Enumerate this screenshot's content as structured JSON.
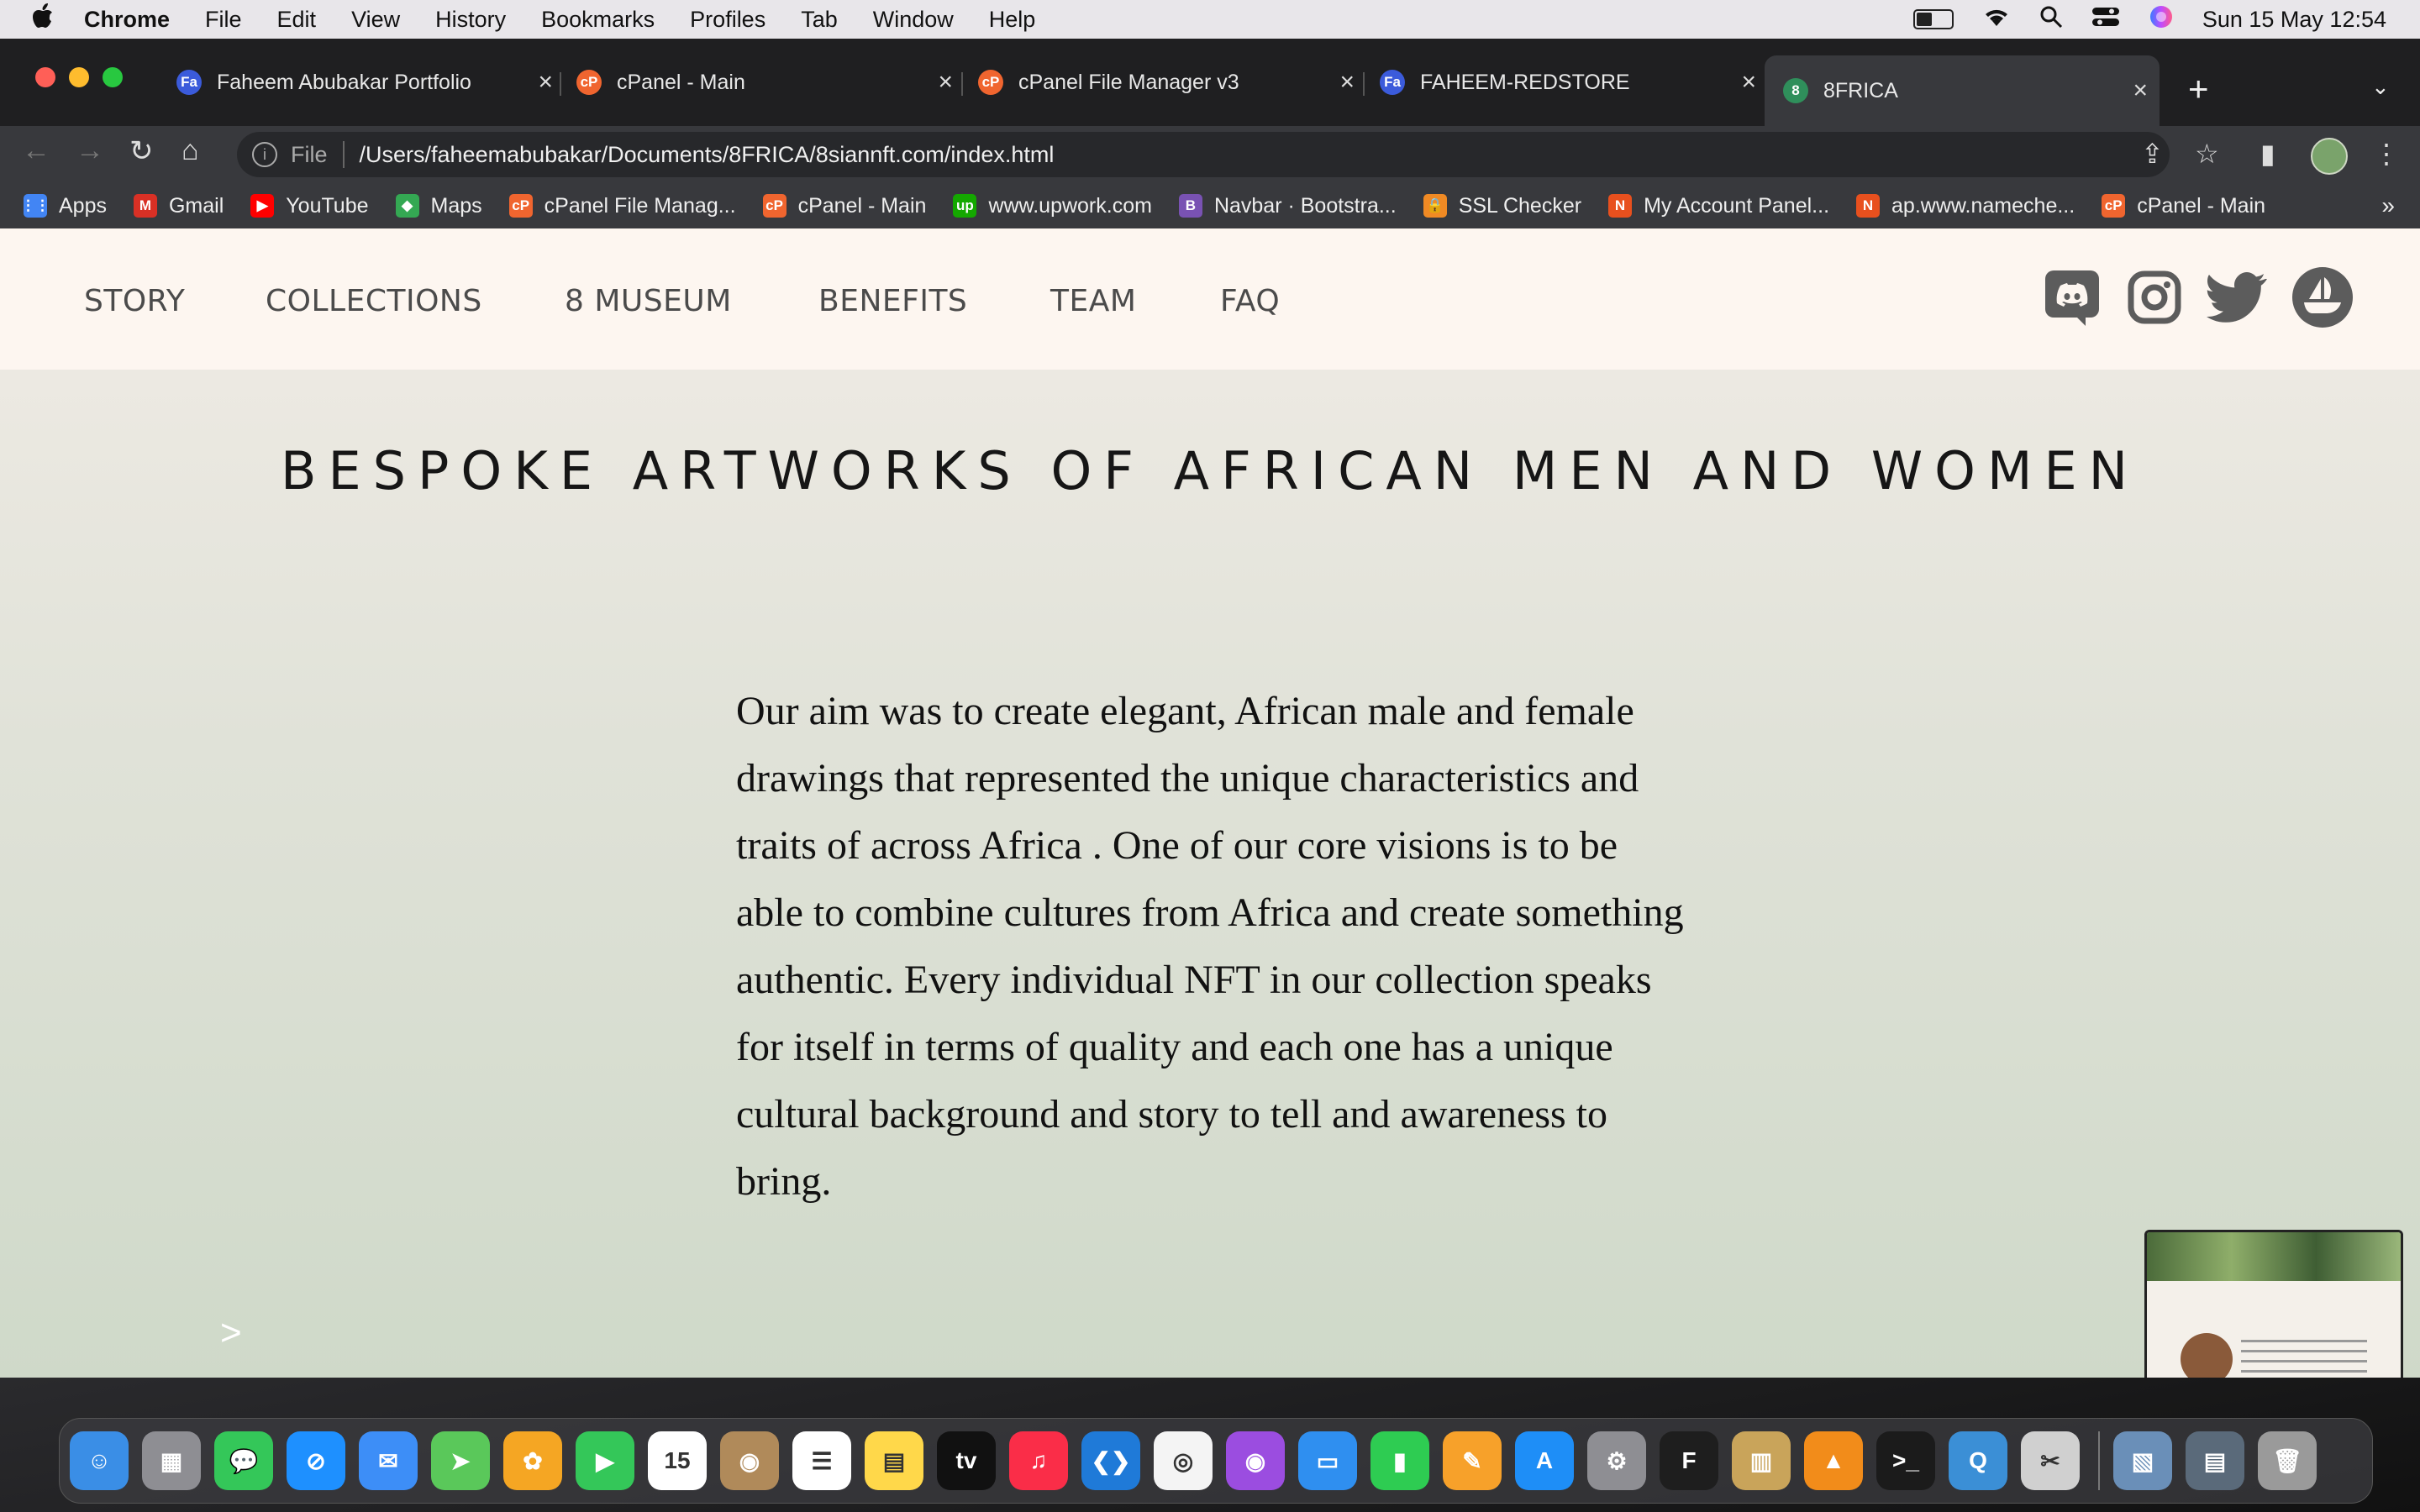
{
  "menubar": {
    "apple": "",
    "items": [
      "Chrome",
      "File",
      "Edit",
      "View",
      "History",
      "Bookmarks",
      "Profiles",
      "Tab",
      "Window",
      "Help"
    ],
    "datetime": "Sun 15 May  12:54",
    "battery_level": 0.45
  },
  "tabs": [
    {
      "title": "Faheem Abubakar Portfolio",
      "icon": "Fa",
      "color": "#3b5bdb",
      "active": false
    },
    {
      "title": "cPanel - Main",
      "icon": "cP",
      "color": "#f0652f",
      "active": false
    },
    {
      "title": "cPanel File Manager v3",
      "icon": "cP",
      "color": "#f0652f",
      "active": false
    },
    {
      "title": "FAHEEM-REDSTORE",
      "icon": "Fa",
      "color": "#3b5bdb",
      "active": false
    },
    {
      "title": "8FRICA",
      "icon": "8",
      "color": "#2f8f5b",
      "active": true
    }
  ],
  "tab_close": "×",
  "new_tab": "+",
  "tab_menu": "⌄",
  "toolbar": {
    "back": "←",
    "forward": "→",
    "reload": "↻",
    "home": "⌂",
    "scheme": "File",
    "url": "/Users/faheemabubakar/Documents/8FRICA/8siannft.com/index.html",
    "share": "⇪",
    "star": "☆",
    "sidepanel": "▮",
    "menu": "⋮"
  },
  "bookmarks": [
    {
      "label": "Apps",
      "icon": "⋮⋮",
      "color": "#4285f4"
    },
    {
      "label": "Gmail",
      "icon": "M",
      "color": "#d93025"
    },
    {
      "label": "YouTube",
      "icon": "▶",
      "color": "#ff0000"
    },
    {
      "label": "Maps",
      "icon": "◆",
      "color": "#34a853"
    },
    {
      "label": "cPanel File Manag...",
      "icon": "cP",
      "color": "#f0652f"
    },
    {
      "label": "cPanel - Main",
      "icon": "cP",
      "color": "#f0652f"
    },
    {
      "label": "www.upwork.com",
      "icon": "up",
      "color": "#14a800"
    },
    {
      "label": "Navbar · Bootstra...",
      "icon": "B",
      "color": "#7952b3"
    },
    {
      "label": "SSL Checker",
      "icon": "🔒",
      "color": "#f08a24"
    },
    {
      "label": "My Account Panel...",
      "icon": "N",
      "color": "#e8501e"
    },
    {
      "label": "ap.www.nameche...",
      "icon": "N",
      "color": "#e8501e"
    },
    {
      "label": "cPanel - Main",
      "icon": "cP",
      "color": "#f0652f"
    }
  ],
  "bookmarks_more": "»",
  "site": {
    "nav": [
      "STORY",
      "COLLECTIONS",
      "8 MUSEUM",
      "BENEFITS",
      "TEAM",
      "FAQ"
    ],
    "social_icons": [
      "discord-icon",
      "instagram-icon",
      "twitter-icon",
      "opensea-icon"
    ],
    "headline": "BESPOKE ARTWORKS OF AFRICAN MEN AND WOMEN",
    "paragraph": "Our aim was to create elegant, African male and female drawings that represented the unique characteristics and traits of across Africa . One of our core visions is to be able to combine cultures from Africa and create something authentic. Every individual NFT in our collection speaks for itself in terms of quality and each one has a unique cultural background and story to tell and awareness to bring.",
    "arrow": ">"
  },
  "dock_icons": [
    {
      "name": "finder-icon",
      "color": "#3a8ee6",
      "glyph": "☺"
    },
    {
      "name": "launchpad-icon",
      "color": "#8e8e93",
      "glyph": "▦"
    },
    {
      "name": "messages-icon",
      "color": "#34c759",
      "glyph": "💬"
    },
    {
      "name": "safari-icon",
      "color": "#1e90ff",
      "glyph": "⊘"
    },
    {
      "name": "mail-icon",
      "color": "#3d8ef7",
      "glyph": "✉"
    },
    {
      "name": "maps-icon",
      "color": "#5ac85a",
      "glyph": "➤"
    },
    {
      "name": "photos-icon",
      "color": "#f5a623",
      "glyph": "✿"
    },
    {
      "name": "facetime-icon",
      "color": "#34c759",
      "glyph": "▶"
    },
    {
      "name": "calendar-icon",
      "color": "#ffffff",
      "glyph": "15"
    },
    {
      "name": "contacts-icon",
      "color": "#b08a5a",
      "glyph": "◉"
    },
    {
      "name": "reminders-icon",
      "color": "#ffffff",
      "glyph": "☰"
    },
    {
      "name": "notes-icon",
      "color": "#ffd84a",
      "glyph": "▤"
    },
    {
      "name": "appletv-icon",
      "color": "#111111",
      "glyph": "tv"
    },
    {
      "name": "music-icon",
      "color": "#fa2d48",
      "glyph": "♫"
    },
    {
      "name": "vscode-icon",
      "color": "#1f7ad8",
      "glyph": "❮❯"
    },
    {
      "name": "chrome-icon",
      "color": "#f4f4f4",
      "glyph": "◎"
    },
    {
      "name": "podcasts-icon",
      "color": "#9b4de0",
      "glyph": "◉"
    },
    {
      "name": "keynote-icon",
      "color": "#2f8ff0",
      "glyph": "▭"
    },
    {
      "name": "numbers-icon",
      "color": "#2ecc52",
      "glyph": "▮"
    },
    {
      "name": "pages-icon",
      "color": "#f7a12a",
      "glyph": "✎"
    },
    {
      "name": "appstore-icon",
      "color": "#1e8ef7",
      "glyph": "A"
    },
    {
      "name": "system-preferences-icon",
      "color": "#8e8e93",
      "glyph": "⚙"
    },
    {
      "name": "figma-icon",
      "color": "#1e1e1e",
      "glyph": "F"
    },
    {
      "name": "archive-utility-icon",
      "color": "#c9a45a",
      "glyph": "▥"
    },
    {
      "name": "vlc-icon",
      "color": "#f28c1a",
      "glyph": "▲"
    },
    {
      "name": "terminal-icon",
      "color": "#1b1b1b",
      "glyph": ">_"
    },
    {
      "name": "quicktime-icon",
      "color": "#3b8fd6",
      "glyph": "Q"
    },
    {
      "name": "screenshot-icon",
      "color": "#d0d0d0",
      "glyph": "✂"
    },
    {
      "name": "preview-icon",
      "color": "#6a8fb8",
      "glyph": "▧"
    },
    {
      "name": "downloads-stack-icon",
      "color": "#5a6a7a",
      "glyph": "▤"
    },
    {
      "name": "trash-icon",
      "color": "#9a9a9a",
      "glyph": "🗑"
    }
  ]
}
